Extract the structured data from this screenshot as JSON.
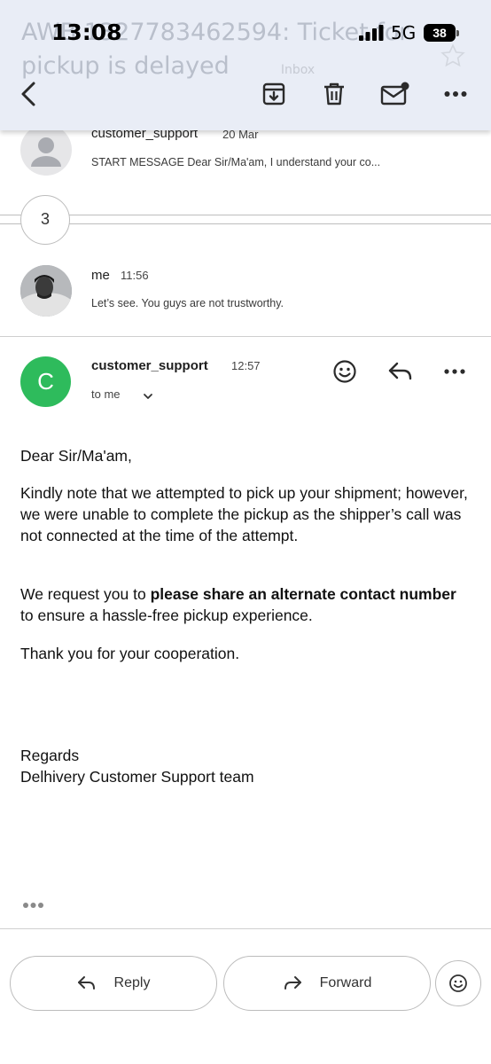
{
  "status_bar": {
    "time": "13:08",
    "network": "5G",
    "battery": "38"
  },
  "header": {
    "subject": "AWB 1327783462594: Ticket for pickup is delayed",
    "label": "Inbox"
  },
  "thread": {
    "first": {
      "sender": "customer_support",
      "date": "20 Mar",
      "snippet": "START MESSAGE Dear Sir/Ma'am, I understand your co..."
    },
    "collapsed_count": "3",
    "second": {
      "sender": "me",
      "time": "11:56",
      "snippet": "Let’s see. You guys are not trustworthy."
    },
    "open": {
      "avatar_letter": "C",
      "avatar_color": "#2ebb5c",
      "sender": "customer_support",
      "time": "12:57",
      "recipient": "to me",
      "greeting": "Dear Sir/Ma'am,",
      "paragraph1": "Kindly note that we attempted to pick up your shipment; however, we were unable to complete the pickup as the shipper’s call was not connected at the time of the attempt.",
      "paragraph2_start": "We request you to ",
      "paragraph2_bold": "please share an alternate contact number",
      "paragraph2_end": " to ensure a hassle-free pickup experience.",
      "paragraph3": "Thank you for your cooperation.",
      "regards": "Regards",
      "team": "Delhivery Customer Support team"
    }
  },
  "actions": {
    "reply": "Reply",
    "forward": "Forward"
  },
  "icons": {
    "back": "chevron-left-icon",
    "archive": "archive-icon",
    "delete": "trash-icon",
    "unread": "mark-unread-icon",
    "more": "more-horizontal-icon",
    "star": "star-icon",
    "emoji": "emoji-icon",
    "reply": "reply-icon",
    "forward": "forward-icon"
  }
}
